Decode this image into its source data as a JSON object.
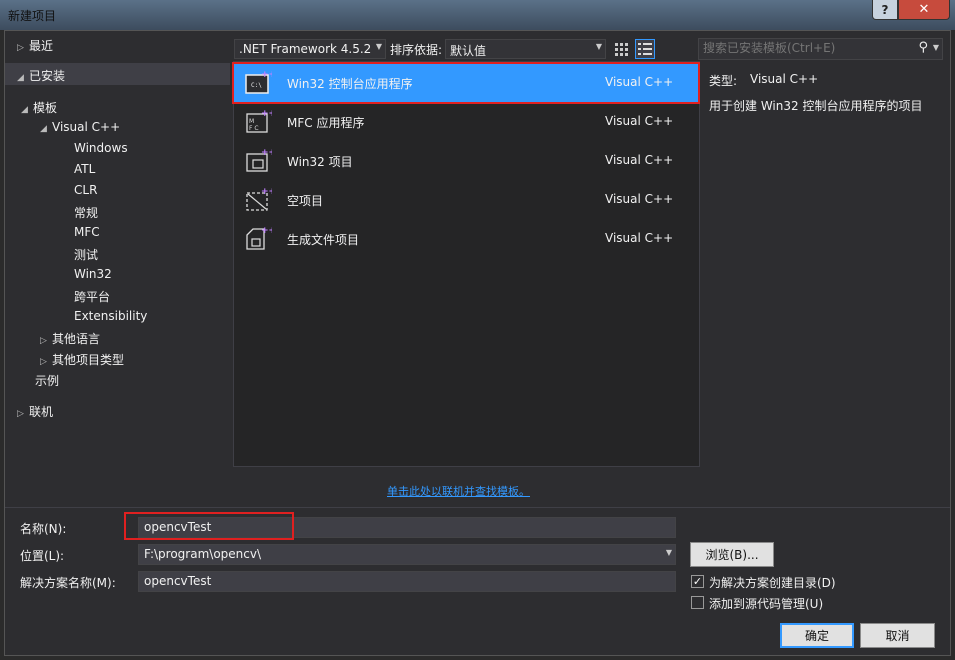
{
  "window": {
    "title": "新建项目",
    "help": "?",
    "close": "✕"
  },
  "tree": {
    "recent": "最近",
    "installed": "已安装",
    "templates": "模板",
    "visual_cpp": "Visual C++",
    "cpp_children": [
      "Windows",
      "ATL",
      "CLR",
      "常规",
      "MFC",
      "测试",
      "Win32",
      "跨平台",
      "Extensibility"
    ],
    "other_languages": "其他语言",
    "other_project_types": "其他项目类型",
    "samples": "示例",
    "online": "联机"
  },
  "toolbar": {
    "framework": ".NET Framework 4.5.2",
    "sort_label": "排序依据:",
    "sort_value": "默认值",
    "search_placeholder": "搜索已安装模板(Ctrl+E)"
  },
  "templates": [
    {
      "name": "Win32 控制台应用程序",
      "lang": "Visual C++",
      "icon": "console-app-icon"
    },
    {
      "name": "MFC 应用程序",
      "lang": "Visual C++",
      "icon": "mfc-app-icon"
    },
    {
      "name": "Win32 项目",
      "lang": "Visual C++",
      "icon": "win32-project-icon"
    },
    {
      "name": "空项目",
      "lang": "Visual C++",
      "icon": "empty-project-icon"
    },
    {
      "name": "生成文件项目",
      "lang": "Visual C++",
      "icon": "makefile-project-icon"
    }
  ],
  "info": {
    "type_label": "类型:",
    "type_value": "Visual C++",
    "description": "用于创建 Win32 控制台应用程序的项目"
  },
  "online_link": "单击此处以联机并查找模板。",
  "form": {
    "name_label": "名称(N):",
    "name_value": "opencvTest",
    "location_label": "位置(L):",
    "location_value": "F:\\program\\opencv\\",
    "solution_label": "解决方案名称(M):",
    "solution_value": "opencvTest",
    "browse": "浏览(B)...",
    "create_dir": "为解决方案创建目录(D)",
    "create_dir_checked": true,
    "source_control": "添加到源代码管理(U)",
    "source_control_checked": false,
    "ok": "确定",
    "cancel": "取消"
  }
}
